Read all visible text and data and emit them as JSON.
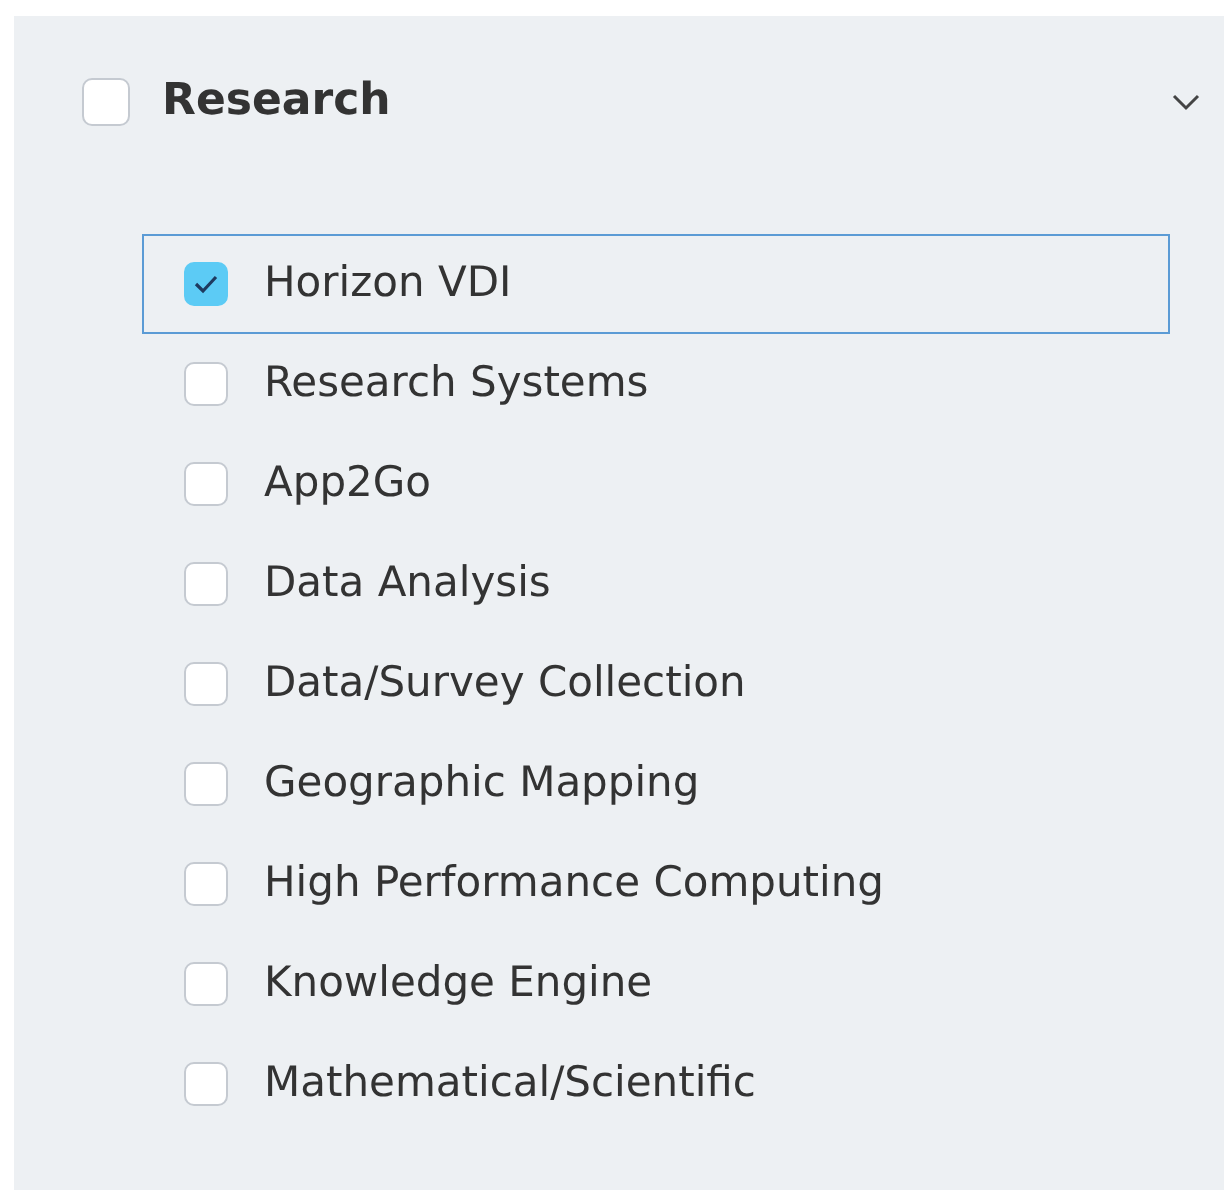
{
  "group": {
    "label": "Research",
    "checked": false,
    "expanded": true
  },
  "options": [
    {
      "label": "Horizon VDI",
      "checked": true,
      "focused": true
    },
    {
      "label": "Research Systems",
      "checked": false,
      "focused": false
    },
    {
      "label": "App2Go",
      "checked": false,
      "focused": false
    },
    {
      "label": "Data Analysis",
      "checked": false,
      "focused": false
    },
    {
      "label": "Data/Survey Collection",
      "checked": false,
      "focused": false
    },
    {
      "label": "Geographic Mapping",
      "checked": false,
      "focused": false
    },
    {
      "label": "High Performance Computing",
      "checked": false,
      "focused": false
    },
    {
      "label": "Knowledge Engine",
      "checked": false,
      "focused": false
    },
    {
      "label": "Mathematical/Scientific",
      "checked": false,
      "focused": false
    }
  ]
}
